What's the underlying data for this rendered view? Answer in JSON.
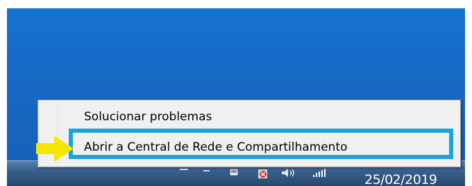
{
  "context_menu": {
    "items": [
      {
        "label": "Solucionar problemas"
      },
      {
        "label": "Abrir a Central de Rede e Compartilhamento"
      }
    ]
  },
  "taskbar": {
    "clock_date": "25/02/2019",
    "tray_icons": [
      "flag-icon",
      "display-icon",
      "network-error-icon",
      "volume-icon",
      "signal-icon"
    ]
  },
  "annotations": {
    "highlight_color": "#1aa3df",
    "arrow_color": "#f5e600"
  },
  "colors": {
    "desktop": "#1668c2",
    "menu_background": "#f0f0f0"
  }
}
